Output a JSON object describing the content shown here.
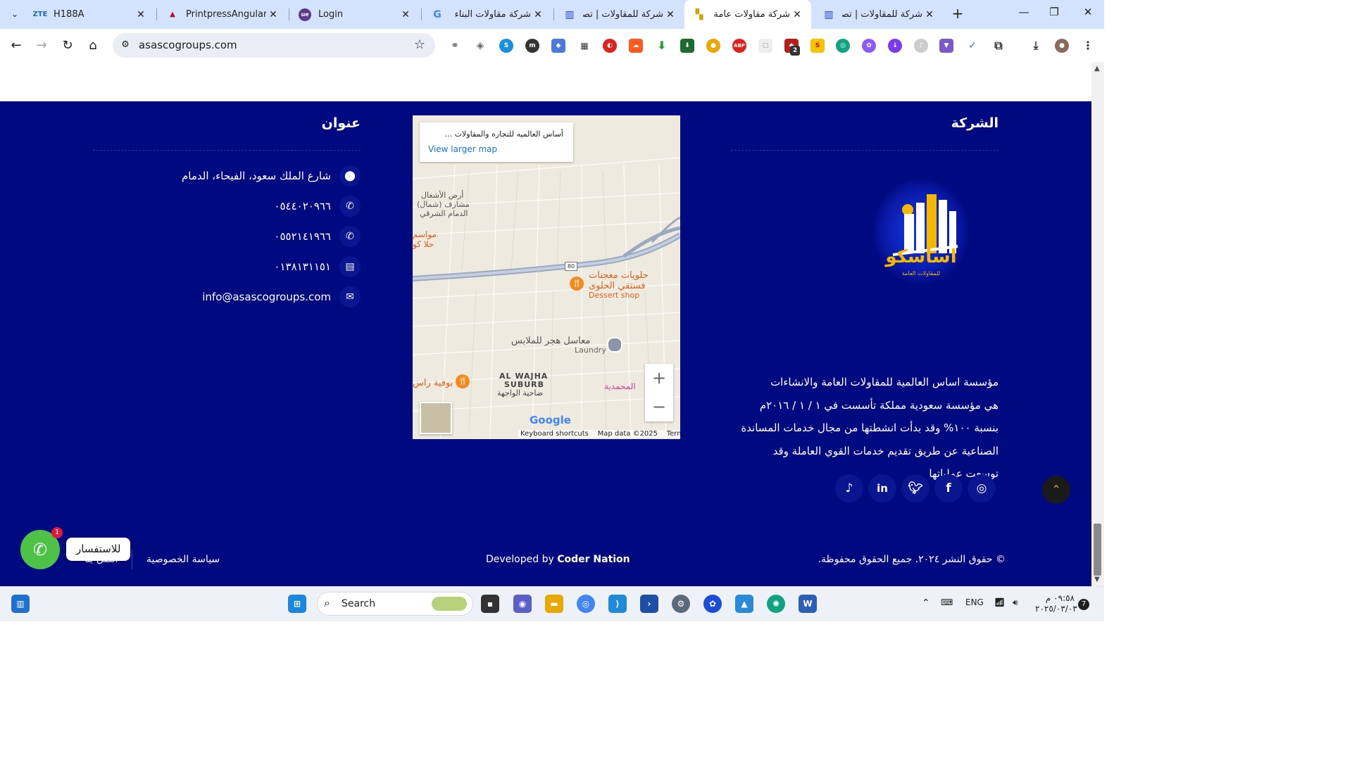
{
  "browser": {
    "tabs": [
      {
        "title": "H188A",
        "favicon_text": "ZTE",
        "favicon_color": "#1a6fc4"
      },
      {
        "title": "PrintpressAngular",
        "favicon_text": "▲",
        "favicon_color": "#c3002f"
      },
      {
        "title": "Login",
        "favicon_text": "ue",
        "favicon_color": "#5b3a8a"
      },
      {
        "title": "شركة مقاولات البناء",
        "favicon_text": "G",
        "favicon_color": "#4285f4"
      },
      {
        "title": "شركة للمقاولات | تصم",
        "favicon_text": "▥",
        "favicon_color": "#1e3cc8"
      },
      {
        "title": "شركة مقاولات عامة بال",
        "favicon_text": "▚",
        "favicon_color": "#d4a400"
      },
      {
        "title": "شركة للمقاولات | تصم",
        "favicon_text": "▥",
        "favicon_color": "#1e3cc8"
      }
    ],
    "new_tab": "+",
    "window_controls": [
      "—",
      "❐",
      "✕"
    ],
    "url": "asascogroups.com",
    "extension_badge": "2"
  },
  "footer": {
    "company_heading": "الشركة",
    "address_heading": "عنوان",
    "about_lines": [
      "مؤسسة اساس العالمية للمقاولات العامة والانشاءات",
      "هي مؤسسة سعودية مملكة تأسست في ١ / ١ / ٢٠١٦م",
      "بنسبة ١٠٠% وقد بدأت انشطتها من مجال خدمات المساندة",
      "الصناعية عن طريق تقديم خدمات القوي العاملة وقد",
      "توسعت عملياتها"
    ],
    "logo_text": "اساسكو",
    "logo_subtext": "للمقاولات العامة",
    "address": "شارع الملك سعود، الفيحاء، الدمام",
    "phone1": "٠٥٤٤٠٢٠٩٦٦",
    "phone2": "٠٥٥٢١٤١٩٦٦",
    "fax": "٠١٣٨١٣١١٥١",
    "email": "info@asascogroups.com",
    "copyright": "© حقوق النشر ٢٠٢٤. جميع الحقوق محفوظة.",
    "developed_by_prefix": "Developed by ",
    "developed_by_name": "Coder Nation",
    "privacy": "سياسة الخصوصية",
    "contact": "اتصل بنا",
    "back_to_top": "⌃"
  },
  "map": {
    "card_title": "أساس العالميه للتجاره والمقاولات ...",
    "view_larger": "View larger map",
    "labels": {
      "a1": "أرض الأشغال",
      "a2": "(شمال) مشارف",
      "a3": "الدمام الشرقي",
      "b1": "مواسم",
      "b2": "حلا كو",
      "road": "80",
      "sweets1": "حلويات معجنات",
      "sweets2": "فستقي الحلوى",
      "sweets3": "Dessert shop",
      "laundry1": "معاسل هجر للملابس",
      "laundry2": "Laundry",
      "suburb1": "AL WAJHA",
      "suburb2": "SUBURB",
      "suburb3": "ضاحية الواجهة",
      "buffet": "بوفية راس",
      "muhammadiya": "المحمدية"
    },
    "zoom_in": "+",
    "zoom_out": "−",
    "google": "Google",
    "shortcuts": "Keyboard shortcuts",
    "map_data": "Map data ©2025",
    "terms": "Terms"
  },
  "whatsapp": {
    "badge": "1",
    "label": "للاستفسار"
  },
  "taskbar": {
    "search_placeholder": "Search",
    "lang": "ENG",
    "time": "٠٩:٥٨ م",
    "date": "٢٠٢٥/٠٣/٠٣",
    "notifications": "7"
  }
}
